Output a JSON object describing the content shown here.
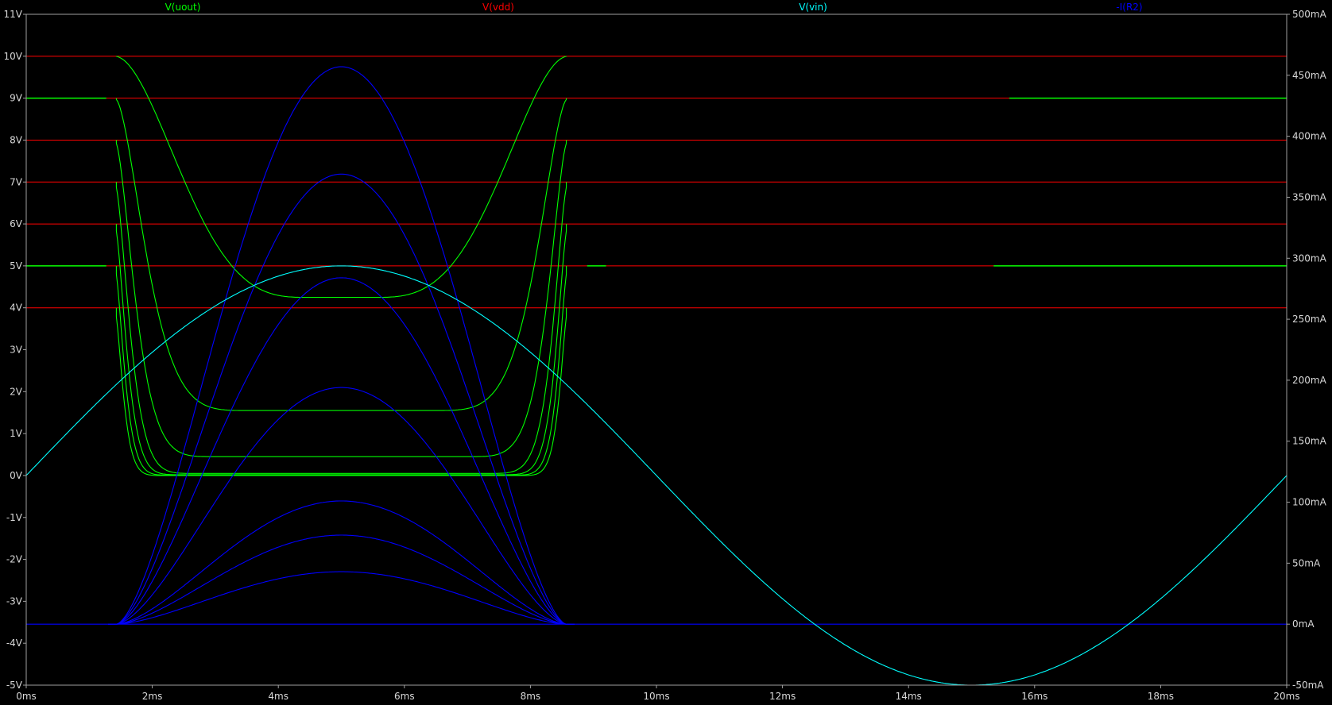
{
  "chart_data": {
    "type": "line",
    "title": "",
    "legend_position": "top",
    "grid": false,
    "colors": {
      "background": "#000000",
      "axes": "#a0a0a0",
      "tick_text": "#d8d8d8"
    },
    "x_axis": {
      "range": [
        0,
        20
      ],
      "ticks": [
        "0ms",
        "2ms",
        "4ms",
        "6ms",
        "8ms",
        "10ms",
        "12ms",
        "14ms",
        "16ms",
        "18ms",
        "20ms"
      ]
    },
    "y_left": {
      "range": [
        -5,
        11
      ],
      "ticks": [
        "-5V",
        "-4V",
        "-3V",
        "-2V",
        "-1V",
        "0V",
        "1V",
        "2V",
        "3V",
        "4V",
        "5V",
        "6V",
        "7V",
        "8V",
        "9V",
        "10V",
        "11V"
      ]
    },
    "y_right": {
      "range": [
        -50,
        500
      ],
      "ticks": [
        "-50mA",
        "0mA",
        "50mA",
        "100mA",
        "150mA",
        "200mA",
        "250mA",
        "300mA",
        "350mA",
        "400mA",
        "450mA",
        "500mA"
      ]
    },
    "traces": [
      {
        "name": "V(uout)",
        "color": "#00ff00",
        "axis": "left"
      },
      {
        "name": "V(vdd)",
        "color": "#ff0000",
        "axis": "left"
      },
      {
        "name": "V(vin)",
        "color": "#00ffff",
        "axis": "left"
      },
      {
        "name": "-I(R2)",
        "color": "#0000ff",
        "axis": "right"
      }
    ],
    "vdd_levels_V": [
      4,
      5,
      6,
      7,
      8,
      9,
      10
    ],
    "vin": {
      "amplitude_V": 5,
      "period_ms": 20
    },
    "uout_series": [
      {
        "vdd_V": 10,
        "min_V": 4.25
      },
      {
        "vdd_V": 9,
        "min_V": 1.55
      },
      {
        "vdd_V": 8,
        "min_V": 0.45
      },
      {
        "vdd_V": 7,
        "min_V": 0.05
      },
      {
        "vdd_V": 6,
        "min_V": 0.02
      },
      {
        "vdd_V": 5,
        "min_V": 0.01
      },
      {
        "vdd_V": 4,
        "min_V": 0.0
      }
    ],
    "current_series": [
      {
        "vdd_V": 10,
        "peak_mA": 457
      },
      {
        "vdd_V": 9,
        "peak_mA": 369
      },
      {
        "vdd_V": 8,
        "peak_mA": 284
      },
      {
        "vdd_V": 7,
        "peak_mA": 194
      },
      {
        "vdd_V": 6,
        "peak_mA": 101
      },
      {
        "vdd_V": 5,
        "peak_mA": 73
      },
      {
        "vdd_V": 4,
        "peak_mA": 43
      }
    ]
  }
}
